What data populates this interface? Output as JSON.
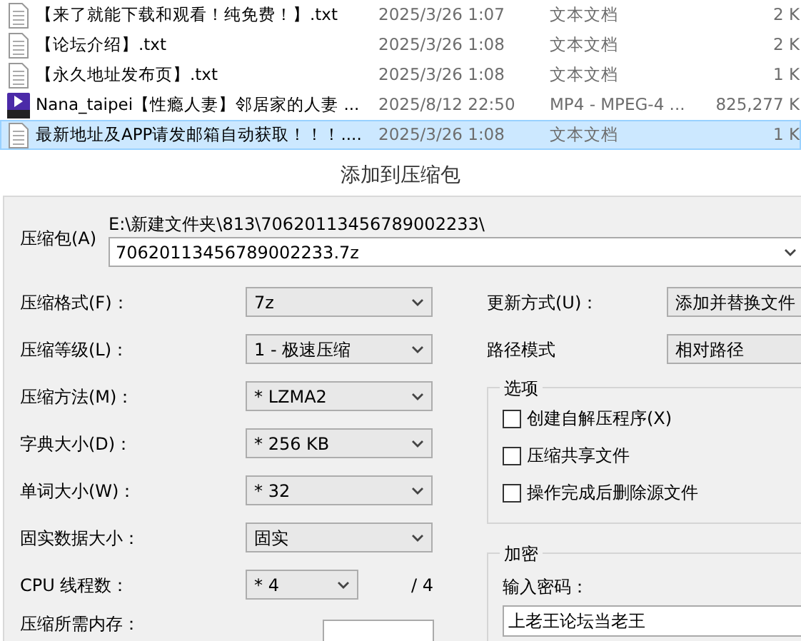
{
  "files": [
    {
      "name": "【来了就能下载和观看！纯免费！】.txt",
      "date": "2025/3/26 1:07",
      "type": "文本文档",
      "size": "2 K",
      "kind": "txt",
      "selected": false
    },
    {
      "name": "【论坛介绍】.txt",
      "date": "2025/3/26 1:08",
      "type": "文本文档",
      "size": "2 K",
      "kind": "txt",
      "selected": false
    },
    {
      "name": "【永久地址发布页】.txt",
      "date": "2025/3/26 1:08",
      "type": "文本文档",
      "size": "1 K",
      "kind": "txt",
      "selected": false
    },
    {
      "name": "Nana_taipei【性瘾人妻】邻居家的人妻 ...",
      "date": "2025/8/12 22:50",
      "type": "MP4 - MPEG-4 ...",
      "size": "825,277 K",
      "kind": "mp4",
      "selected": false
    },
    {
      "name": "最新地址及APP请发邮箱自动获取！！！....",
      "date": "2025/3/26 1:08",
      "type": "文本文档",
      "size": "1 K",
      "kind": "txt",
      "selected": true
    }
  ],
  "dialog": {
    "title": "添加到压缩包",
    "archive": {
      "label": "压缩包(A)",
      "path": "E:\\新建文件夹\\813\\70620113456789002233\\",
      "value": "70620113456789002233.7z"
    },
    "settings": [
      {
        "label": "压缩格式(F)：",
        "value": "7z"
      },
      {
        "label": "压缩等级(L)：",
        "value": "1 - 极速压缩"
      },
      {
        "label": "压缩方法(M)：",
        "value": "* LZMA2"
      },
      {
        "label": "字典大小(D)：",
        "value": "* 256 KB"
      },
      {
        "label": "单词大小(W)：",
        "value": "* 32"
      },
      {
        "label": "固实数据大小：",
        "value": "固实"
      },
      {
        "label": "CPU 线程数：",
        "value": "* 4",
        "suffix": "/ 4"
      }
    ],
    "memory_label": "压缩所需内存：",
    "update": {
      "label": "更新方式(U)：",
      "value": "添加并替换文件"
    },
    "path_mode": {
      "label": "路径模式",
      "value": "相对路径"
    },
    "options": {
      "title": "选项",
      "items": [
        {
          "label": "创建自解压程序(X)",
          "checked": false
        },
        {
          "label": "压缩共享文件",
          "checked": false
        },
        {
          "label": "操作完成后删除源文件",
          "checked": false
        }
      ]
    },
    "encryption": {
      "title": "加密",
      "password_label": "输入密码：",
      "password": "上老王论坛当老王"
    }
  }
}
